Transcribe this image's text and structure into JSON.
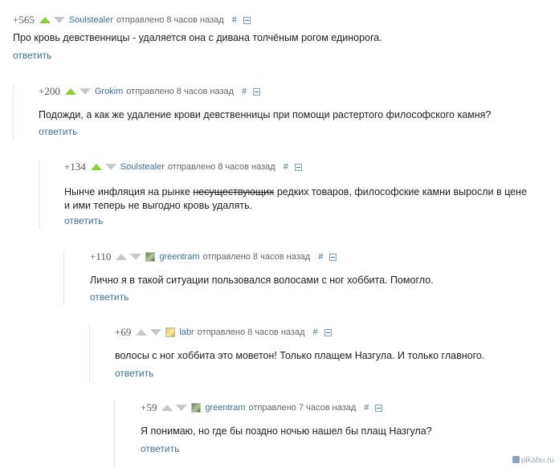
{
  "comments": [
    {
      "score": "+565",
      "upvoted": true,
      "username": "Soulstealer",
      "posted": "отправлено 8 часов назад",
      "hash": "#",
      "text": "Про кровь девственницы - удаляется она с дивана толчёным рогом единорога.",
      "reply": "ответить"
    },
    {
      "score": "+200",
      "upvoted": true,
      "username": "Grokim",
      "posted": "отправлено 8 часов назад",
      "hash": "#",
      "text": "Подожди, а как же удаление крови девственницы при помощи растертого философского камня?",
      "reply": "ответить"
    },
    {
      "score": "+134",
      "upvoted": true,
      "username": "Soulstealer",
      "posted": "отправлено 8 часов назад",
      "hash": "#",
      "text_before": "Нынче инфляция на рынке ",
      "text_strike": "несуществующих",
      "text_after": " редких товаров, философские камни выросли в цене",
      "text_line2": "и ими теперь не выгодно кровь удалять.",
      "reply": "ответить"
    },
    {
      "score": "+110",
      "upvoted": false,
      "avatar": "green-avatar",
      "username": "greentram",
      "posted": "отправлено 8 часов назад",
      "hash": "#",
      "text": "Лично я в такой ситуации пользовался волосами с ног хоббита. Помогло.",
      "reply": "ответить"
    },
    {
      "score": "+69",
      "upvoted": false,
      "avatar": "yellow-avatar",
      "username": "labr",
      "posted": "отправлено 8 часов назад",
      "hash": "#",
      "text": "волосы с ног хоббита это моветон! Только плащем Назгула. И только главного.",
      "reply": "ответить"
    },
    {
      "score": "+59",
      "upvoted": false,
      "avatar": "green-avatar",
      "username": "greentram",
      "posted": "отправлено 7 часов назад",
      "hash": "#",
      "text": "Я понимаю, но где бы поздно ночью нашел бы плащ Назгула?",
      "reply": "ответить"
    }
  ],
  "watermark": "pikabu.ru",
  "colors": {
    "link": "#3f6e8e",
    "upvote": "#8dcc3b",
    "vote_inactive": "#c8c8c8",
    "text": "#222222"
  }
}
